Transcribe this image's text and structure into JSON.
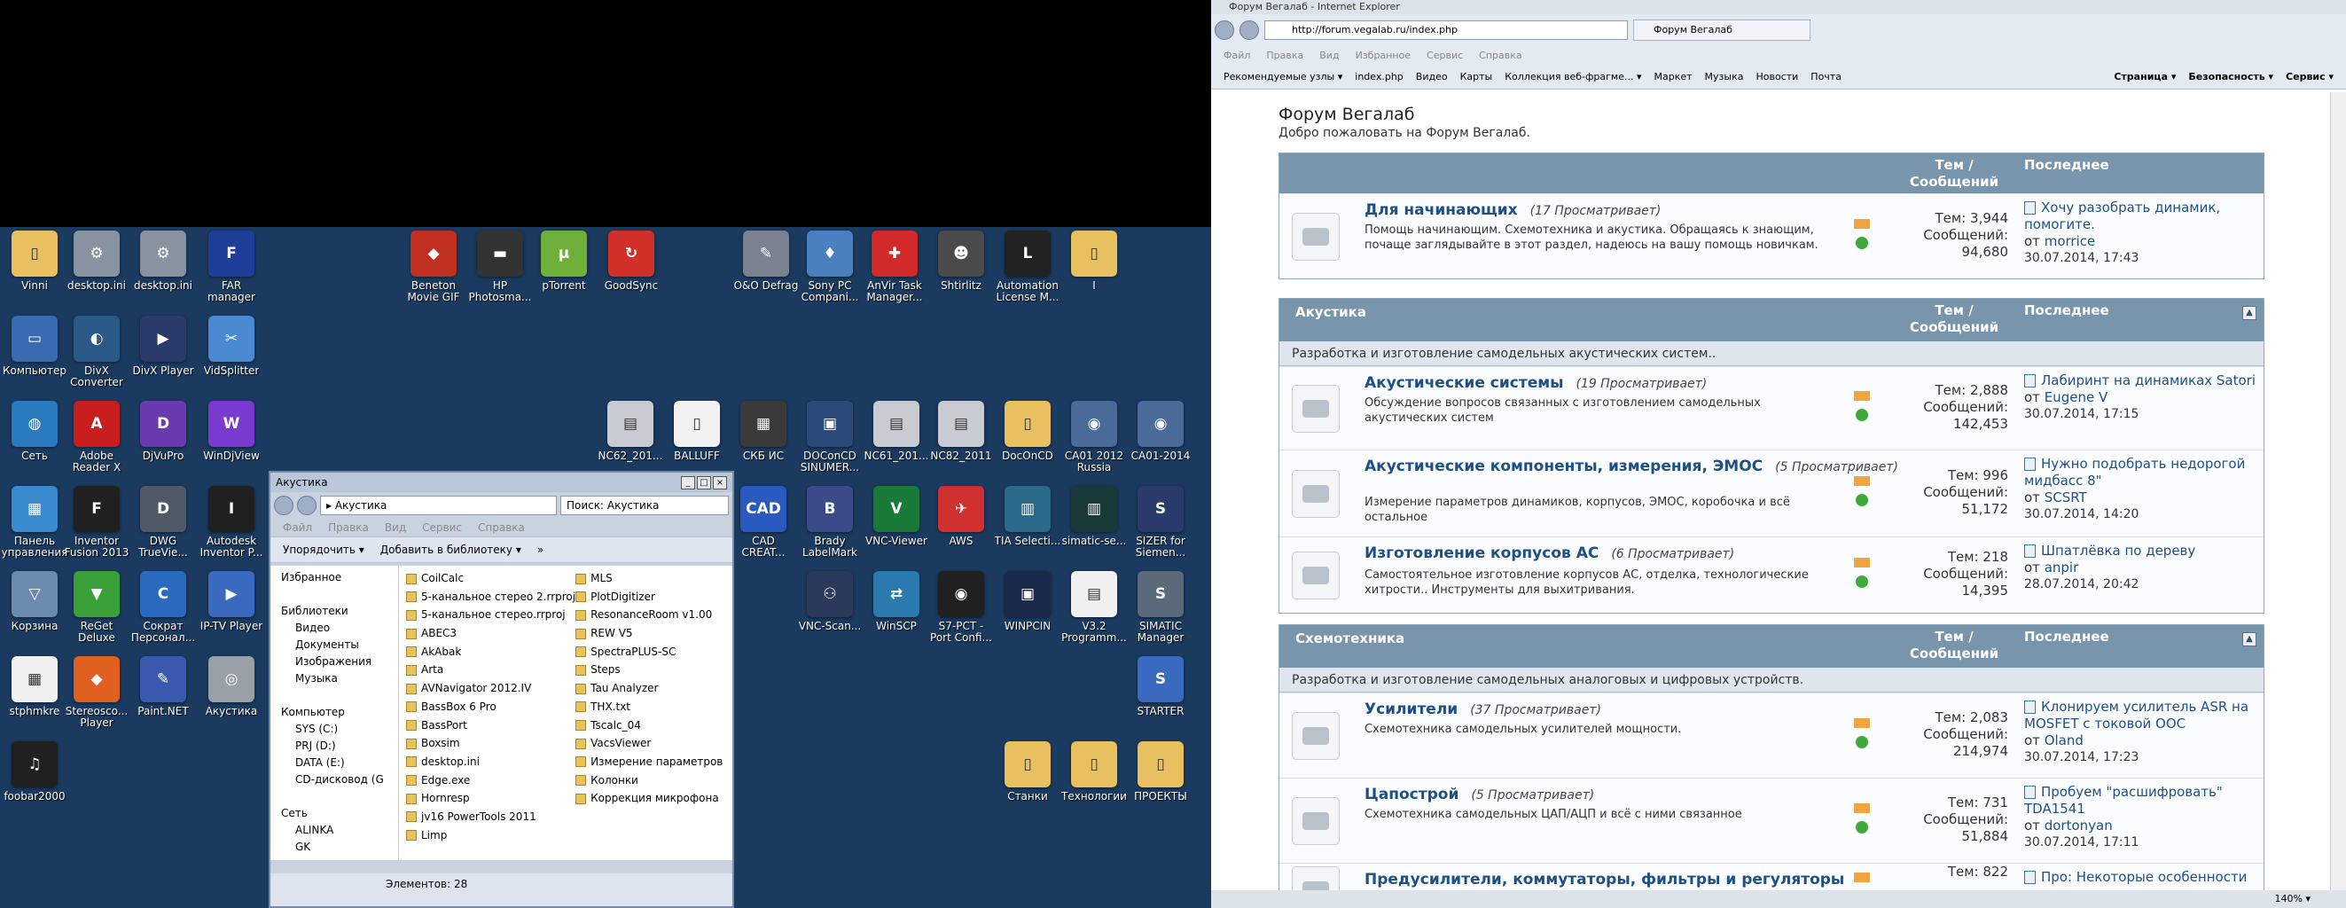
{
  "desktop": {
    "icons": [
      {
        "label": "Vinni",
        "color": "#e8c060",
        "glyph": "▯"
      },
      {
        "label": "desktop.ini",
        "color": "#8892a0",
        "glyph": "⚙"
      },
      {
        "label": "desktop.ini",
        "color": "#8892a0",
        "glyph": "⚙"
      },
      {
        "label": "FAR manager",
        "color": "#1d3f9a",
        "glyph": "F"
      },
      {
        "label": "Beneton Movie GIF",
        "color": "#c03020",
        "glyph": "◆"
      },
      {
        "label": "HP Photosma...",
        "color": "#333333",
        "glyph": "▬"
      },
      {
        "label": "pTorrent",
        "color": "#6fb03a",
        "glyph": "µ"
      },
      {
        "label": "GoodSync",
        "color": "#d03028",
        "glyph": "↻"
      },
      {
        "label": "O&O Defrag",
        "color": "#7a8290",
        "glyph": "✎"
      },
      {
        "label": "Sony PC Compani...",
        "color": "#4a7fc0",
        "glyph": "♦"
      },
      {
        "label": "AnVir Task Manager...",
        "color": "#d02a2a",
        "glyph": "✚"
      },
      {
        "label": "Shtirlitz",
        "color": "#4a4a4a",
        "glyph": "☻"
      },
      {
        "label": "Automation License M...",
        "color": "#222222",
        "glyph": "L"
      },
      {
        "label": "I",
        "color": "#e8c060",
        "glyph": "▯"
      },
      {
        "label": "Компьютер",
        "color": "#3a6ab0",
        "glyph": "▭"
      },
      {
        "label": "DivX Converter",
        "color": "#2a5a8a",
        "glyph": "◐"
      },
      {
        "label": "DivX Player",
        "color": "#2a3a6a",
        "glyph": "▶"
      },
      {
        "label": "VidSplitter",
        "color": "#4a8ad0",
        "glyph": "✂"
      },
      {
        "label": "Сеть",
        "color": "#2a7ac0",
        "glyph": "◍"
      },
      {
        "label": "Adobe Reader X",
        "color": "#c81e1e",
        "glyph": "A"
      },
      {
        "label": "DjVuPro",
        "color": "#6a3ab0",
        "glyph": "D"
      },
      {
        "label": "WinDjView",
        "color": "#7a3ad0",
        "glyph": "W"
      },
      {
        "label": "NC62_201...",
        "color": "#c8ccd2",
        "glyph": "▤"
      },
      {
        "label": "BALLUFF",
        "color": "#f2f2f2",
        "glyph": "▯"
      },
      {
        "label": "СКБ ИС",
        "color": "#3a3a3a",
        "glyph": "▦"
      },
      {
        "label": "DOConCD SINUMER...",
        "color": "#2a4a7a",
        "glyph": "▣"
      },
      {
        "label": "NC61_201...",
        "color": "#c8ccd2",
        "glyph": "▤"
      },
      {
        "label": "NC82_2011",
        "color": "#c8ccd2",
        "glyph": "▤"
      },
      {
        "label": "DocOnCD",
        "color": "#e8c060",
        "glyph": "▯"
      },
      {
        "label": "CA01 2012 Russia",
        "color": "#4a6a9a",
        "glyph": "◉"
      },
      {
        "label": "CA01-2014",
        "color": "#4a6a9a",
        "glyph": "◉"
      },
      {
        "label": "Панель управления",
        "color": "#3a8ad0",
        "glyph": "▦"
      },
      {
        "label": "Inventor Fusion 2013",
        "color": "#202020",
        "glyph": "F"
      },
      {
        "label": "DWG TrueVie...",
        "color": "#505a66",
        "glyph": "D"
      },
      {
        "label": "Autodesk Inventor P...",
        "color": "#202020",
        "glyph": "I"
      },
      {
        "label": "CAD CREAT...",
        "color": "#2a5ac0",
        "glyph": "CAD"
      },
      {
        "label": "Brady LabelMark",
        "color": "#3a4a8a",
        "glyph": "B"
      },
      {
        "label": "VNC-Viewer",
        "color": "#1a7a3a",
        "glyph": "V"
      },
      {
        "label": "AWS",
        "color": "#d03030",
        "glyph": "✈"
      },
      {
        "label": "TIA Selecti...",
        "color": "#2a6a8a",
        "glyph": "▥"
      },
      {
        "label": "simatic-se...",
        "color": "#1a3a3a",
        "glyph": "▥"
      },
      {
        "label": "SIZER for Siemen...",
        "color": "#2a3a6a",
        "glyph": "S"
      },
      {
        "label": "Корзина",
        "color": "#6a8ab0",
        "glyph": "▽"
      },
      {
        "label": "ReGet Deluxe",
        "color": "#3aa03a",
        "glyph": "▼"
      },
      {
        "label": "Сократ Персонал...",
        "color": "#2a6ac0",
        "glyph": "С"
      },
      {
        "label": "IP-TV Player",
        "color": "#3a6ac0",
        "glyph": "▶"
      },
      {
        "label": "VNC-Scan...",
        "color": "#2a3a5a",
        "glyph": "⚇"
      },
      {
        "label": "WinSCP",
        "color": "#2a7ab0",
        "glyph": "⇄"
      },
      {
        "label": "S7-PCT - Port Confi...",
        "color": "#202020",
        "glyph": "◉"
      },
      {
        "label": "WINPCIN",
        "color": "#1a2a4a",
        "glyph": "▣"
      },
      {
        "label": "V3.2 Programm...",
        "color": "#f0f0f0",
        "glyph": "▤"
      },
      {
        "label": "SIMATIC Manager",
        "color": "#5a6a7a",
        "glyph": "S"
      },
      {
        "label": "stphmkre",
        "color": "#f0f0f0",
        "glyph": "▦"
      },
      {
        "label": "Stereosco... Player",
        "color": "#e06020",
        "glyph": "◆"
      },
      {
        "label": "Paint.NET",
        "color": "#3a5ab0",
        "glyph": "✎"
      },
      {
        "label": "Акустика",
        "color": "#9aa0a8",
        "glyph": "◎"
      },
      {
        "label": "STARTER",
        "color": "#3a6ac0",
        "glyph": "S"
      },
      {
        "label": "foobar2000",
        "color": "#202020",
        "glyph": "♫"
      },
      {
        "label": "Станки",
        "color": "#e8c060",
        "glyph": "▯"
      },
      {
        "label": "Технологии",
        "color": "#e8c060",
        "glyph": "▯"
      },
      {
        "label": "ПРОЕКТЫ",
        "color": "#e8c060",
        "glyph": "▯"
      }
    ]
  },
  "explorer": {
    "title": "Акустика",
    "crumb": "▸ Акустика",
    "search_placeholder": "Поиск: Акустика",
    "menu": [
      "Файл",
      "Правка",
      "Вид",
      "Сервис",
      "Справка"
    ],
    "organize": "Упорядочить ▾",
    "add_to_library": "Добавить в библиотеку ▾",
    "more": "»",
    "nav": [
      "Избранное",
      "",
      "Библиотеки",
      "Видео",
      "Документы",
      "Изображения",
      "Музыка",
      "",
      "Компьютер",
      "SYS (C:)",
      "PRJ (D:)",
      "DATA (E:)",
      "CD-дисковод (G",
      "",
      "Сеть",
      "ALINKA",
      "GK"
    ],
    "files_col1": [
      "CoilCalc",
      "5-канальное стерео 2.rrproj",
      "5-канальное стерео.rrproj",
      "ABEC3",
      "AkAbak",
      "Arta",
      "AVNavigator 2012.IV",
      "BassBox 6 Pro",
      "BassPort",
      "Boxsim",
      "desktop.ini",
      "Edge.exe",
      "Hornresp",
      "jv16 PowerTools 2011",
      "Limp"
    ],
    "files_col2": [
      "MLS",
      "PlotDigitizer",
      "ResonanceRoom v1.00",
      "REW V5",
      "SpectraPLUS-SC",
      "Steps",
      "Tau Analyzer",
      "THX.txt",
      "Tscalc_04",
      "VacsViewer",
      "Измерение параметров",
      "Колонки",
      "Коррекция микрофона"
    ],
    "status": "Элементов: 28"
  },
  "ie": {
    "window_title": "Форум Вегалаб - Internet Explorer",
    "url": "http://forum.vegalab.ru/index.php",
    "tab": "Форум Вегалаб",
    "menu": [
      "Файл",
      "Правка",
      "Вид",
      "Избранное",
      "Сервис",
      "Справка"
    ],
    "favorites": [
      "Рекомендуемые узлы ▾",
      "index.php",
      "Видео",
      "Карты",
      "Коллекция веб-фрагме... ▾",
      "Маркет",
      "Музыка",
      "Новости",
      "Почта"
    ],
    "commands": [
      "Страница ▾",
      "Безопасность ▾",
      "Сервис ▾"
    ],
    "zoom": "140% ▾"
  },
  "forum": {
    "title": "Форум Вегалаб",
    "welcome": "Добро пожаловать на Форум Вегалаб.",
    "col_threads": "Тем / Сообщений",
    "col_last": "Последнее",
    "collapse": "▲",
    "top_forum": {
      "name": "Для начинающих",
      "views": "(17 Просматривает)",
      "desc": "Помощь начинающим. Схемотехника и акустика. Обращаясь к знающим, почаще заглядывайте в этот раздел, надеюсь на вашу помощь новичкам.",
      "threads": "Тем: 3,944",
      "posts_label": "Сообщений:",
      "posts": "94,680",
      "last_title": "Хочу разобрать динамик, помогите.",
      "last_by": "от",
      "last_user": "morrice",
      "last_date": "30.07.2014, 17:43"
    },
    "cat1": {
      "name": "Акустика",
      "desc": "Разработка и изготовление самодельных акустических систем..",
      "forums": [
        {
          "name": "Акустические системы",
          "views": "(19 Просматривает)",
          "desc": "Обсуждение вопросов связанных с изготовлением самодельных акустических систем",
          "threads": "Тем: 2,888",
          "posts_label": "Сообщений:",
          "posts": "142,453",
          "last_title": "Лабиринт на динамиках Satori",
          "last_by": "от",
          "last_user": "Eugene V",
          "last_date": "30.07.2014, 17:15"
        },
        {
          "name": "Акустические компоненты, измерения, ЭМОС",
          "views": "(5 Просматривает)",
          "desc": "Измерение параметров динамиков, корпусов, ЭМОС, коробочка и всё остальное",
          "threads": "Тем: 996",
          "posts_label": "Сообщений:",
          "posts": "51,172",
          "last_title": "Нужно подобрать недорогой мидбасс 8\"",
          "last_by": "от",
          "last_user": "SCSRT",
          "last_date": "30.07.2014, 14:20"
        },
        {
          "name": "Изготовление корпусов АС",
          "views": "(6 Просматривает)",
          "desc": "Самостоятельное изготовление корпусов АС, отделка, технологические хитрости.. Инструменты для выхитривания.",
          "threads": "Тем: 218",
          "posts_label": "Сообщений:",
          "posts": "14,395",
          "last_title": "Шпатлёвка по дереву",
          "last_by": "от",
          "last_user": "anpir",
          "last_date": "28.07.2014, 20:42"
        }
      ]
    },
    "cat2": {
      "name": "Схемотехника",
      "desc": "Разработка и изготовление самодельных аналоговых и цифровых устройств.",
      "forums": [
        {
          "name": "Усилители",
          "views": "(37 Просматривает)",
          "desc": "Схемотехника самодельных усилителей мощности.",
          "threads": "Тем: 2,083",
          "posts_label": "Сообщений:",
          "posts": "214,974",
          "last_title": "Клонируем усилитель ASR на MOSFET с токовой ООС",
          "last_by": "от",
          "last_user": "Oland",
          "last_date": "30.07.2014, 17:23"
        },
        {
          "name": "Цапострой",
          "views": "(5 Просматривает)",
          "desc": "Схемотехника самодельных ЦАП/АЦП и всё с ними связанное",
          "threads": "Тем: 731",
          "posts_label": "Сообщений:",
          "posts": "51,884",
          "last_title": "Пробуем \"расшифровать\" TDA1541",
          "last_by": "от",
          "last_user": "dortonyan",
          "last_date": "30.07.2014, 17:11"
        },
        {
          "name": "Предусилители, коммутаторы, фильтры и регуляторы",
          "views": "",
          "desc": "",
          "threads": "Тем: 822",
          "posts_label": "",
          "posts": "",
          "last_title": "Про: Некоторые особенности",
          "last_by": "",
          "last_user": "",
          "last_date": ""
        }
      ]
    }
  }
}
